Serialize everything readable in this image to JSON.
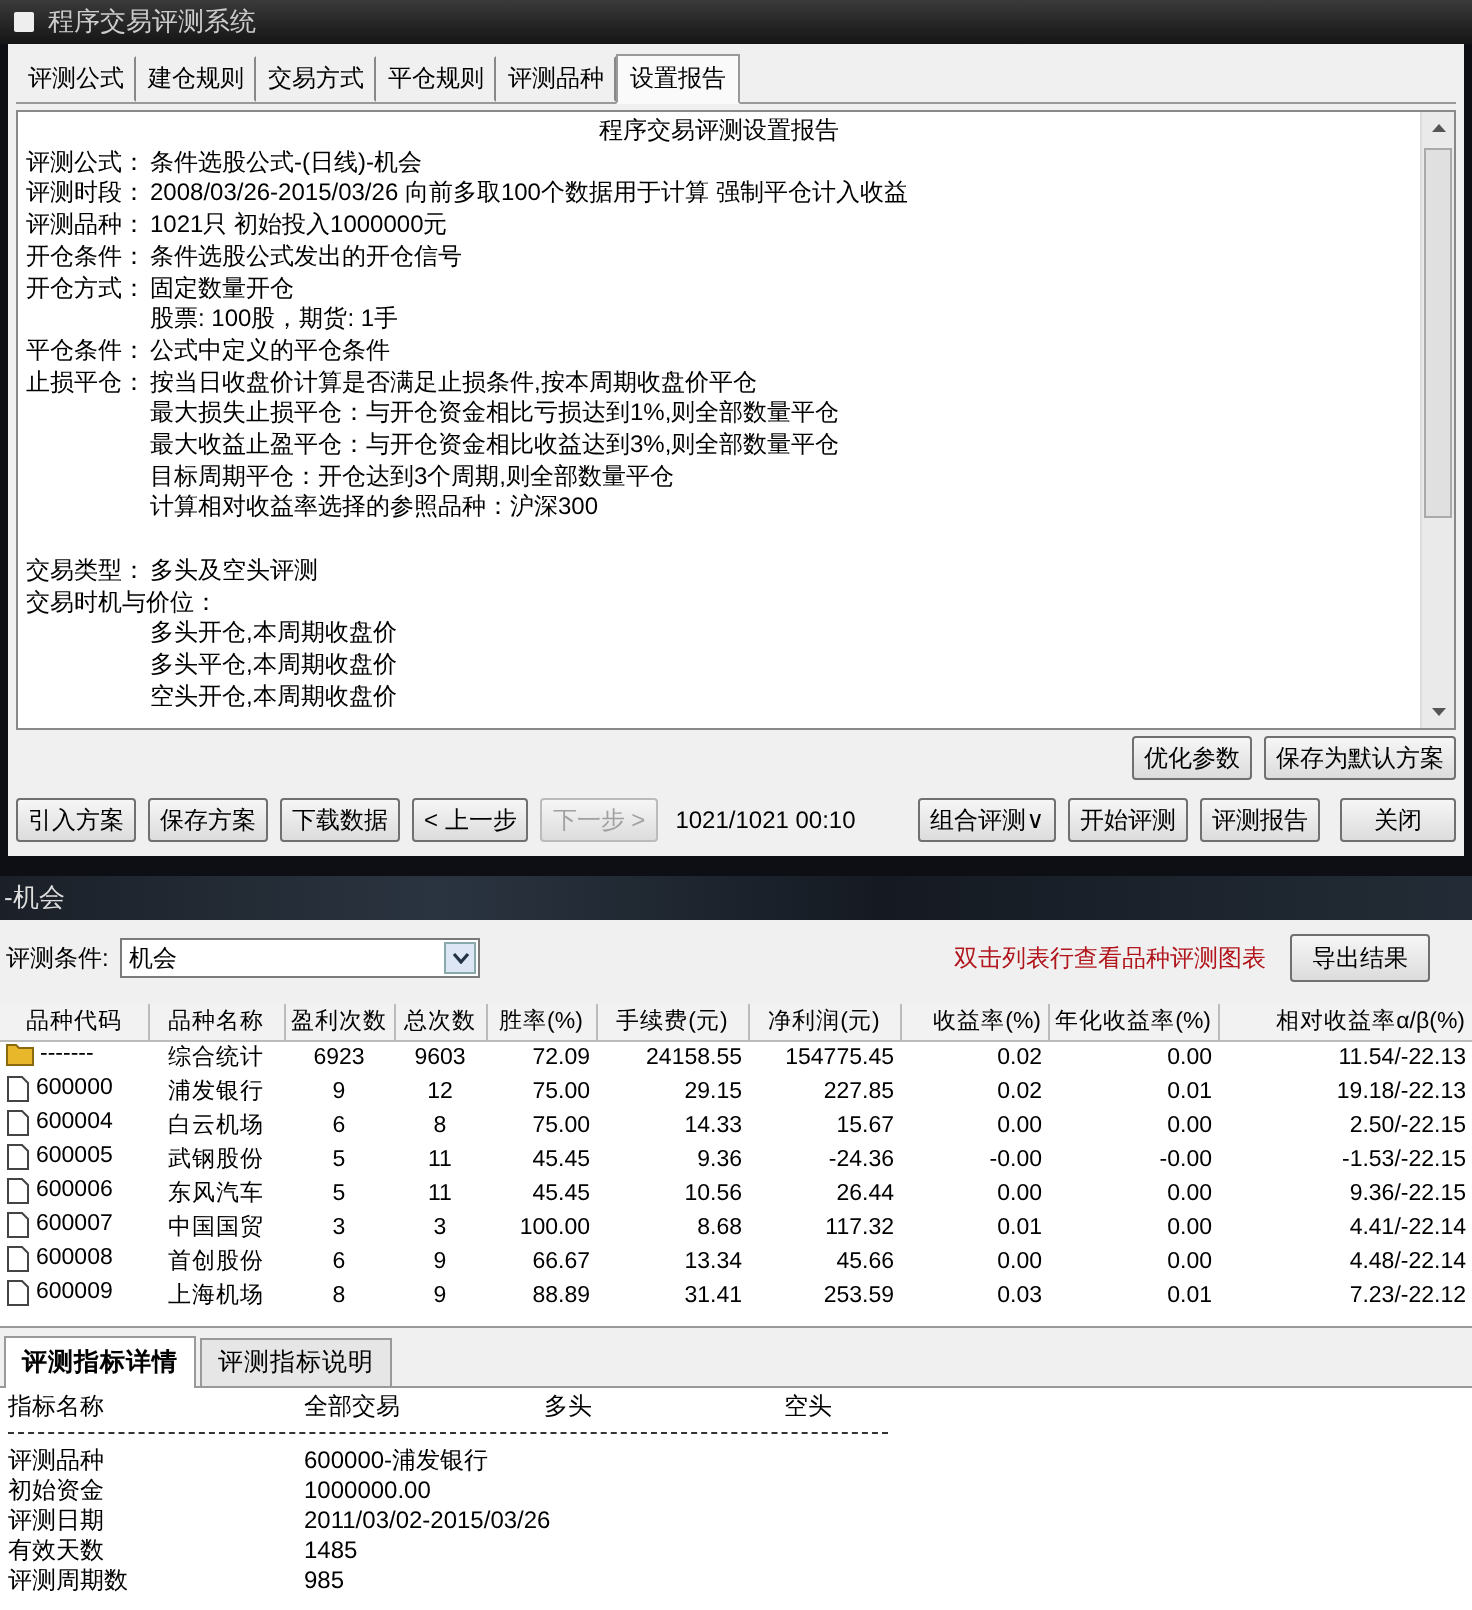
{
  "window": {
    "title": "程序交易评测系统"
  },
  "tabs": [
    {
      "label": "评测公式",
      "selected": false
    },
    {
      "label": "建仓规则",
      "selected": false
    },
    {
      "label": "交易方式",
      "selected": false
    },
    {
      "label": "平仓规则",
      "selected": false
    },
    {
      "label": "评测品种",
      "selected": false
    },
    {
      "label": "设置报告",
      "selected": true
    }
  ],
  "report": {
    "title": "程序交易评测设置报告",
    "entries": [
      {
        "label": "评测公式：",
        "lines": [
          "条件选股公式-(日线)-机会"
        ]
      },
      {
        "label": "评测时段：",
        "lines": [
          "2008/03/26-2015/03/26 向前多取100个数据用于计算 强制平仓计入收益"
        ]
      },
      {
        "label": "评测品种：",
        "lines": [
          "1021只 初始投入1000000元"
        ]
      },
      {
        "label": "开仓条件：",
        "lines": [
          "条件选股公式发出的开仓信号"
        ]
      },
      {
        "label": "开仓方式：",
        "lines": [
          "固定数量开仓",
          "股票: 100股，期货: 1手"
        ]
      },
      {
        "label": "平仓条件：",
        "lines": [
          "公式中定义的平仓条件"
        ]
      },
      {
        "label": "止损平仓：",
        "lines": [
          "按当日收盘价计算是否满足止损条件,按本周期收盘价平仓",
          "最大损失止损平仓：与开仓资金相比亏损达到1%,则全部数量平仓",
          "最大收益止盈平仓：与开仓资金相比收益达到3%,则全部数量平仓",
          "目标周期平仓：开仓达到3个周期,则全部数量平仓",
          "计算相对收益率选择的参照品种：沪深300"
        ]
      },
      {
        "label": "交易类型：",
        "lines": [
          "多头及空头评测"
        ],
        "gap_before": true
      },
      {
        "label": "交易时机与价位：",
        "lines": [
          "多头开仓,本周期收盘价",
          "多头平仓,本周期收盘价",
          "空头开仓,本周期收盘价"
        ],
        "lines_below": true
      }
    ]
  },
  "report_buttons": [
    "优化参数",
    "保存为默认方案"
  ],
  "toolbar": {
    "left_buttons": [
      {
        "label": "引入方案",
        "disabled": false
      },
      {
        "label": "保存方案",
        "disabled": false
      },
      {
        "label": "下载数据",
        "disabled": false
      },
      {
        "label": "< 上一步",
        "disabled": false
      },
      {
        "label": "下一步 >",
        "disabled": true
      }
    ],
    "progress": "1021/1021  00:10",
    "right_buttons": [
      {
        "label": "组合评测∨",
        "disabled": false
      },
      {
        "label": "开始评测",
        "disabled": false
      },
      {
        "label": "评测报告",
        "disabled": false
      },
      {
        "label": "关闭",
        "disabled": false
      }
    ]
  },
  "result_window": {
    "title": "-机会",
    "condition_label": "评测条件:",
    "condition_value": "机会",
    "hint": "双击列表行查看品种评测图表",
    "export_button": "导出结果"
  },
  "table": {
    "columns": [
      "品种代码",
      "品种名称",
      "盈利次数",
      "总次数",
      "胜率(%)",
      "手续费(元)",
      "净利润(元)",
      "收益率(%)",
      "年化收益率(%)",
      "相对收益率α/β(%)"
    ],
    "rows": [
      {
        "kind": "folder",
        "cells": [
          "-------",
          "综合统计",
          "6923",
          "9603",
          "72.09",
          "24158.55",
          "154775.45",
          "0.02",
          "0.00",
          "11.54/-22.13"
        ]
      },
      {
        "kind": "file",
        "cells": [
          "600000",
          "浦发银行",
          "9",
          "12",
          "75.00",
          "29.15",
          "227.85",
          "0.02",
          "0.01",
          "19.18/-22.13"
        ]
      },
      {
        "kind": "file",
        "cells": [
          "600004",
          "白云机场",
          "6",
          "8",
          "75.00",
          "14.33",
          "15.67",
          "0.00",
          "0.00",
          "2.50/-22.15"
        ]
      },
      {
        "kind": "file",
        "cells": [
          "600005",
          "武钢股份",
          "5",
          "11",
          "45.45",
          "9.36",
          "-24.36",
          "-0.00",
          "-0.00",
          "-1.53/-22.15"
        ]
      },
      {
        "kind": "file",
        "cells": [
          "600006",
          "东风汽车",
          "5",
          "11",
          "45.45",
          "10.56",
          "26.44",
          "0.00",
          "0.00",
          "9.36/-22.15"
        ]
      },
      {
        "kind": "file",
        "cells": [
          "600007",
          "中国国贸",
          "3",
          "3",
          "100.00",
          "8.68",
          "117.32",
          "0.01",
          "0.00",
          "4.41/-22.14"
        ]
      },
      {
        "kind": "file",
        "cells": [
          "600008",
          "首创股份",
          "6",
          "9",
          "66.67",
          "13.34",
          "45.66",
          "0.00",
          "0.00",
          "4.48/-22.14"
        ]
      },
      {
        "kind": "file",
        "cells": [
          "600009",
          "上海机场",
          "8",
          "9",
          "88.89",
          "31.41",
          "253.59",
          "0.03",
          "0.01",
          "7.23/-22.12"
        ]
      }
    ]
  },
  "detail_tabs": [
    {
      "label": "评测指标详情",
      "selected": true
    },
    {
      "label": "评测指标说明",
      "selected": false
    }
  ],
  "details": {
    "columns": [
      "指标名称",
      "全部交易",
      "多头",
      "空头"
    ],
    "rows": [
      [
        "评测品种",
        "600000-浦发银行"
      ],
      [
        "初始资金",
        "1000000.00"
      ],
      [
        "评测日期",
        "2011/03/02-2015/03/26"
      ],
      [
        "有效天数",
        "1485"
      ],
      [
        "评测周期数",
        "985"
      ]
    ]
  }
}
